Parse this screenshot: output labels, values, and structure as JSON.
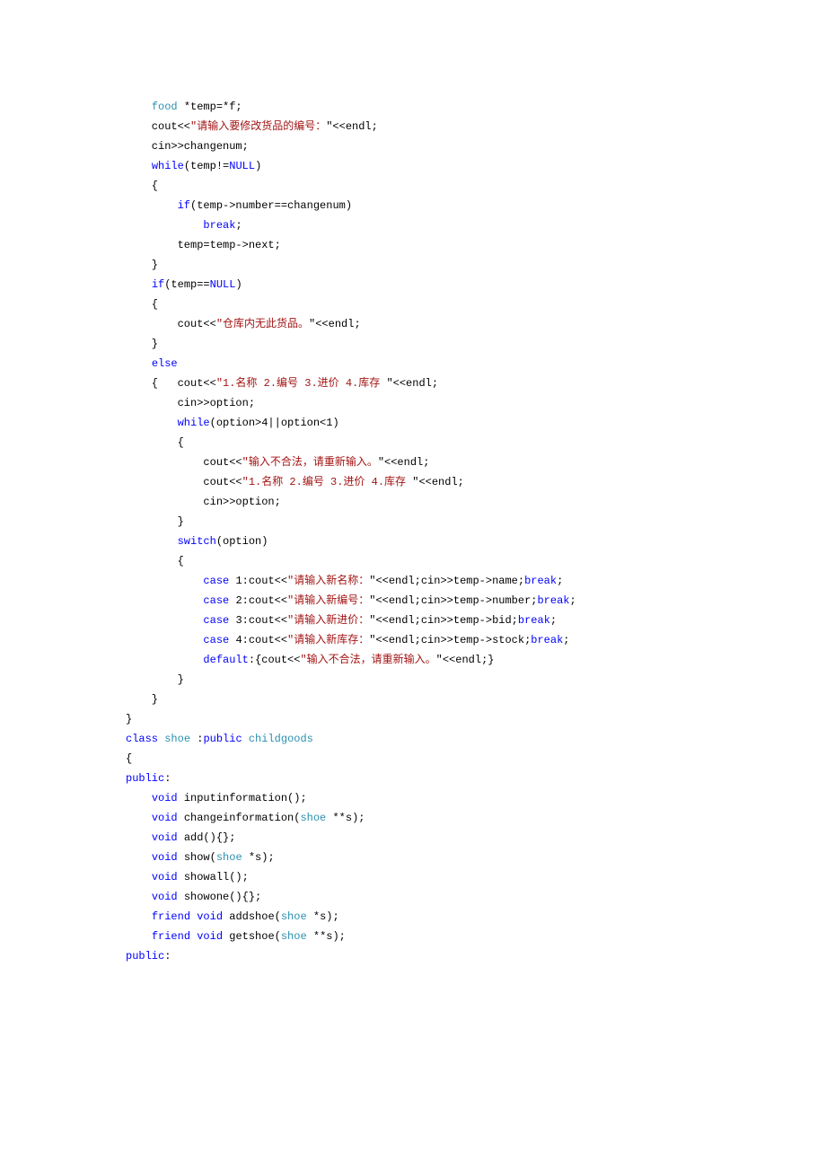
{
  "lines": [
    [
      {
        "t": "    "
      },
      {
        "t": "food",
        "c": "type"
      },
      {
        "t": " *temp=*f;"
      }
    ],
    [
      {
        "t": "    cout<<"
      },
      {
        "t": "\"请输入要修改货品的编号："
      },
      {
        "t": "\"<<endl;"
      }
    ],
    [
      {
        "t": "    cin>>changenum;"
      }
    ],
    [
      {
        "t": "    "
      },
      {
        "t": "while",
        "c": "kw"
      },
      {
        "t": "(temp!="
      },
      {
        "t": "NULL",
        "c": "kw"
      },
      {
        "t": ")"
      }
    ],
    [
      {
        "t": "    {"
      }
    ],
    [
      {
        "t": "        "
      },
      {
        "t": "if",
        "c": "kw"
      },
      {
        "t": "(temp->number==changenum)"
      }
    ],
    [
      {
        "t": "            "
      },
      {
        "t": "break",
        "c": "kw"
      },
      {
        "t": ";"
      }
    ],
    [
      {
        "t": "        temp=temp->next;"
      }
    ],
    [
      {
        "t": "    }"
      }
    ],
    [
      {
        "t": "    "
      },
      {
        "t": "if",
        "c": "kw"
      },
      {
        "t": "(temp=="
      },
      {
        "t": "NULL",
        "c": "kw"
      },
      {
        "t": ")"
      }
    ],
    [
      {
        "t": "    {"
      }
    ],
    [
      {
        "t": "        cout<<"
      },
      {
        "t": "\"仓库内无此货品。"
      },
      {
        "t": "\"<<endl;"
      }
    ],
    [
      {
        "t": "    }"
      }
    ],
    [
      {
        "t": "    "
      },
      {
        "t": "else",
        "c": "kw"
      }
    ],
    [
      {
        "t": "    {   cout<<"
      },
      {
        "t": "\"1.名称 2.编号 3.进价 4.库存 "
      },
      {
        "t": "\"<<endl;"
      }
    ],
    [
      {
        "t": "        cin>>option;"
      }
    ],
    [
      {
        "t": "        "
      },
      {
        "t": "while",
        "c": "kw"
      },
      {
        "t": "(option>4||option<1)"
      }
    ],
    [
      {
        "t": "        {"
      }
    ],
    [
      {
        "t": "            cout<<"
      },
      {
        "t": "\"输入不合法，请重新输入。"
      },
      {
        "t": "\"<<endl;"
      }
    ],
    [
      {
        "t": "            cout<<"
      },
      {
        "t": "\"1.名称 2.编号 3.进价 4.库存 "
      },
      {
        "t": "\"<<endl;"
      }
    ],
    [
      {
        "t": "            cin>>option;"
      }
    ],
    [
      {
        "t": "        }"
      }
    ],
    [
      {
        "t": "        "
      },
      {
        "t": "switch",
        "c": "kw"
      },
      {
        "t": "(option)"
      }
    ],
    [
      {
        "t": "        {"
      }
    ],
    [
      {
        "t": "            "
      },
      {
        "t": "case ",
        "c": "kw"
      },
      {
        "t": "1:cout<<"
      },
      {
        "t": "\"请输入新名称："
      },
      {
        "t": "\"<<endl;cin>>temp->name;"
      },
      {
        "t": "break",
        "c": "kw"
      },
      {
        "t": ";"
      }
    ],
    [
      {
        "t": "            "
      },
      {
        "t": "case ",
        "c": "kw"
      },
      {
        "t": "2:cout<<"
      },
      {
        "t": "\"请输入新编号："
      },
      {
        "t": "\"<<endl;cin>>temp->number;"
      },
      {
        "t": "break",
        "c": "kw"
      },
      {
        "t": ";"
      }
    ],
    [
      {
        "t": "            "
      },
      {
        "t": "case ",
        "c": "kw"
      },
      {
        "t": "3:cout<<"
      },
      {
        "t": "\"请输入新进价："
      },
      {
        "t": "\"<<endl;cin>>temp->bid;"
      },
      {
        "t": "break",
        "c": "kw"
      },
      {
        "t": ";"
      }
    ],
    [
      {
        "t": "            "
      },
      {
        "t": "case ",
        "c": "kw"
      },
      {
        "t": "4:cout<<"
      },
      {
        "t": "\"请输入新库存："
      },
      {
        "t": "\"<<endl;cin>>temp->stock;"
      },
      {
        "t": "break",
        "c": "kw"
      },
      {
        "t": ";"
      }
    ],
    [
      {
        "t": "            "
      },
      {
        "t": "default",
        "c": "kw"
      },
      {
        "t": ":{cout<<"
      },
      {
        "t": "\"输入不合法，请重新输入。"
      },
      {
        "t": "\"<<endl;}"
      }
    ],
    [
      {
        "t": "        }"
      }
    ],
    [
      {
        "t": "    }"
      }
    ],
    [
      {
        "t": "}"
      }
    ],
    [
      {
        "t": "class",
        "c": "kw"
      },
      {
        "t": " "
      },
      {
        "t": "shoe",
        "c": "type"
      },
      {
        "t": " :"
      },
      {
        "t": "public",
        "c": "kw"
      },
      {
        "t": " "
      },
      {
        "t": "childgoods",
        "c": "type"
      }
    ],
    [
      {
        "t": "{"
      }
    ],
    [
      {
        "t": "public",
        "c": "kw"
      },
      {
        "t": ":"
      }
    ],
    [
      {
        "t": "    "
      },
      {
        "t": "void",
        "c": "kw"
      },
      {
        "t": " inputinformation();"
      }
    ],
    [
      {
        "t": "    "
      },
      {
        "t": "void",
        "c": "kw"
      },
      {
        "t": " changeinformation("
      },
      {
        "t": "shoe",
        "c": "type"
      },
      {
        "t": " **s);"
      }
    ],
    [
      {
        "t": "    "
      },
      {
        "t": "void",
        "c": "kw"
      },
      {
        "t": " add(){};"
      }
    ],
    [
      {
        "t": "    "
      },
      {
        "t": "void",
        "c": "kw"
      },
      {
        "t": " show("
      },
      {
        "t": "shoe",
        "c": "type"
      },
      {
        "t": " *s);"
      }
    ],
    [
      {
        "t": "    "
      },
      {
        "t": "void",
        "c": "kw"
      },
      {
        "t": " showall();"
      }
    ],
    [
      {
        "t": "    "
      },
      {
        "t": "void",
        "c": "kw"
      },
      {
        "t": " showone(){};"
      }
    ],
    [
      {
        "t": "    "
      },
      {
        "t": "friend",
        "c": "kw"
      },
      {
        "t": " "
      },
      {
        "t": "void",
        "c": "kw"
      },
      {
        "t": " addshoe("
      },
      {
        "t": "shoe",
        "c": "type"
      },
      {
        "t": " *s);"
      }
    ],
    [
      {
        "t": "    "
      },
      {
        "t": "friend",
        "c": "kw"
      },
      {
        "t": " "
      },
      {
        "t": "void",
        "c": "kw"
      },
      {
        "t": " getshoe("
      },
      {
        "t": "shoe",
        "c": "type"
      },
      {
        "t": " **s);"
      }
    ],
    [
      {
        "t": "public",
        "c": "kw"
      },
      {
        "t": ":"
      }
    ]
  ]
}
